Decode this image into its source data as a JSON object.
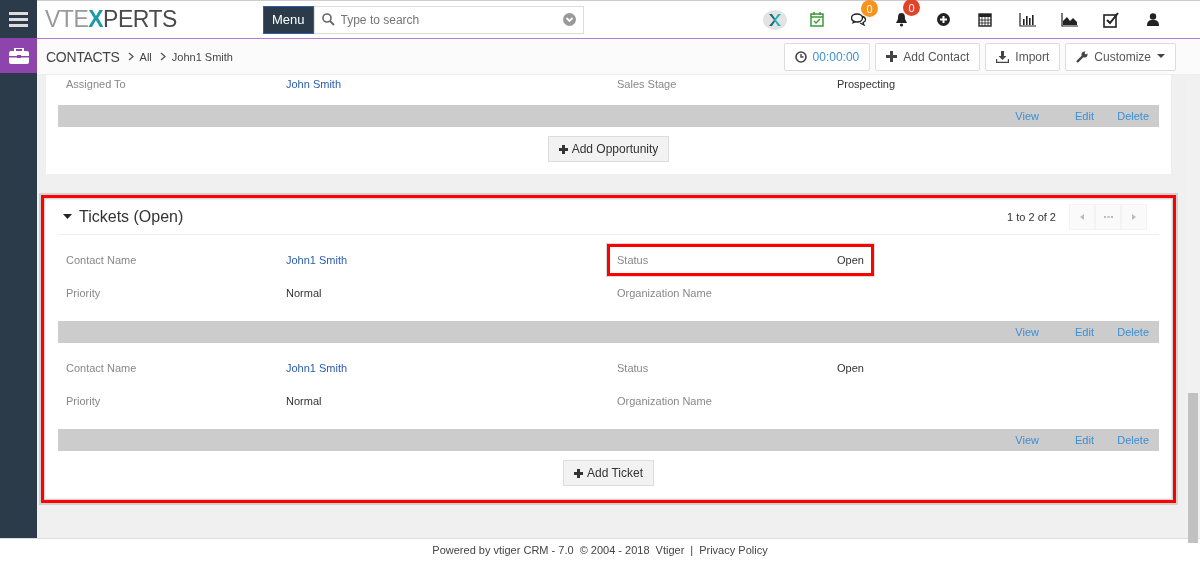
{
  "logo": {
    "parts": [
      "VTE",
      "X",
      "PERTS"
    ]
  },
  "menu_button": "Menu",
  "search": {
    "placeholder": "Type to search"
  },
  "toolbar": [
    {
      "kind": "brand"
    },
    {
      "kind": "calendar-check"
    },
    {
      "kind": "chat",
      "badge": "0",
      "color": "#f7931e"
    },
    {
      "kind": "bell",
      "badge": "0",
      "color": "#e0452a"
    },
    {
      "kind": "plus"
    },
    {
      "kind": "calendar"
    },
    {
      "kind": "bars"
    },
    {
      "kind": "area"
    },
    {
      "kind": "checkbox"
    },
    {
      "kind": "user"
    }
  ],
  "breadcrumb": {
    "module": "CONTACTS",
    "items": [
      "All",
      "John1 Smith"
    ]
  },
  "actions": [
    {
      "kind": "timer",
      "label": "00:00:00"
    },
    {
      "kind": "add",
      "label": "Add Contact"
    },
    {
      "kind": "import",
      "label": "Import"
    },
    {
      "kind": "customize",
      "label": "Customize"
    }
  ],
  "sections": [
    {
      "highlighted": false,
      "records": [
        {
          "rows": [
            [
              {
                "label": "Assigned To",
                "value": "John Smith",
                "kind": "link"
              },
              {
                "label": "Sales Stage",
                "value": "Prospecting",
                "kind": "text"
              }
            ]
          ],
          "actions": [
            "View",
            "Edit",
            "Delete"
          ]
        }
      ],
      "add_button": "Add Opportunity"
    },
    {
      "title": "Tickets (Open)",
      "highlighted": true,
      "pagination": "1 to 2 of 2",
      "records": [
        {
          "rows": [
            [
              {
                "label": "Contact Name",
                "value": "John1 Smith",
                "kind": "link"
              },
              {
                "label": "Status",
                "value": "Open",
                "kind": "text",
                "highlighted": true
              }
            ],
            [
              {
                "label": "Priority",
                "value": "Normal",
                "kind": "text"
              },
              {
                "label": "Organization Name"
              }
            ]
          ],
          "actions": [
            "View",
            "Edit",
            "Delete"
          ]
        },
        {
          "rows": [
            [
              {
                "label": "Contact Name",
                "value": "John1 Smith",
                "kind": "link"
              },
              {
                "label": "Status",
                "value": "Open",
                "kind": "text"
              }
            ],
            [
              {
                "label": "Priority",
                "value": "Normal",
                "kind": "text"
              },
              {
                "label": "Organization Name"
              }
            ]
          ],
          "actions": [
            "View",
            "Edit",
            "Delete"
          ]
        }
      ],
      "add_button": "Add Ticket"
    }
  ],
  "footer": {
    "text": "Powered by vtiger CRM - 7.0  © 2004 - 2018",
    "link": "Vtiger",
    "separator": "|",
    "privacy": "Privacy Policy"
  }
}
